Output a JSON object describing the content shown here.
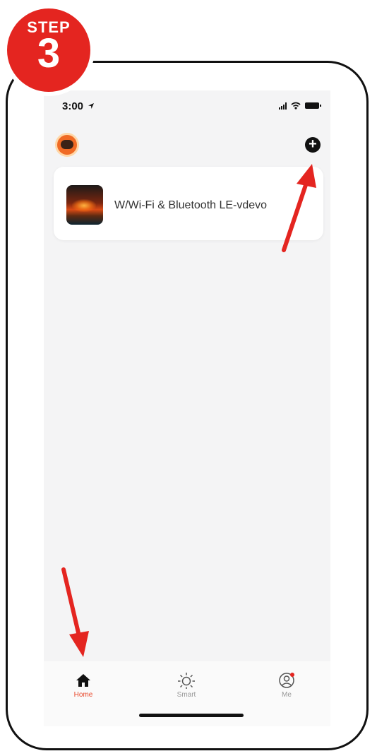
{
  "step": {
    "label": "STEP",
    "number": "3"
  },
  "status_bar": {
    "time": "3:00"
  },
  "header": {
    "avatar": "app-avatar-icon",
    "add_button": "plus-circle-icon"
  },
  "devices": [
    {
      "name": "W/Wi-Fi & Bluetooth LE-vdevo",
      "thumbnail": "fireplace-thumbnail"
    }
  ],
  "tabs": [
    {
      "label": "Home",
      "icon": "home-icon",
      "active": true
    },
    {
      "label": "Smart",
      "icon": "sun-icon",
      "active": false
    },
    {
      "label": "Me",
      "icon": "profile-icon",
      "active": false
    }
  ],
  "colors": {
    "accent": "#e42520",
    "active_tab": "#e8472a",
    "background": "#f4f4f5"
  }
}
